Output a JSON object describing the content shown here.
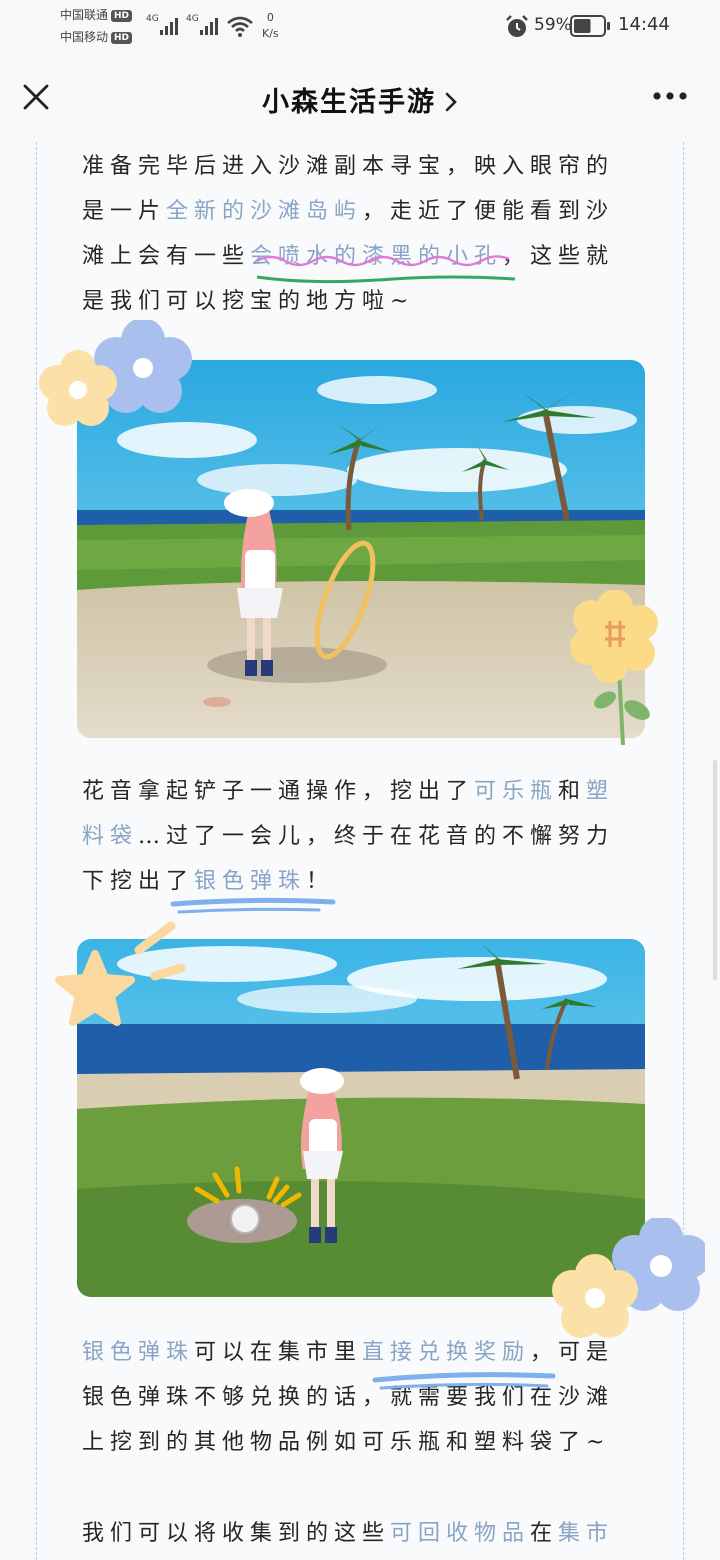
{
  "status": {
    "carrier1": "中国联通",
    "carrier2": "中国移动",
    "hd_badge": "HD",
    "network1": "4G",
    "network2": "4G",
    "speed_value": "0",
    "speed_unit": "K/s",
    "battery": "59%",
    "battery_level": 0.59,
    "time": "14:44"
  },
  "nav": {
    "title": "小森生活手游",
    "chevron": "chevron-right-icon",
    "close_icon": "close-icon",
    "more_icon": "more-icon"
  },
  "article": {
    "p1": [
      [
        {
          "t": "准备完毕后进入沙滩副本寻宝，映入眼帘的"
        }
      ],
      [
        {
          "t": "是一片"
        },
        {
          "t": "全新的沙滩岛屿",
          "h": 1
        },
        {
          "t": "，走近了便能看到沙"
        }
      ],
      [
        {
          "t": "滩上会有一些"
        },
        {
          "t": "会喷水的漆黑的小孔",
          "h": 1
        },
        {
          "t": "，这些就"
        }
      ],
      [
        {
          "t": "是我们可以挖宝的地方啦~"
        }
      ]
    ],
    "p2": [
      [
        {
          "t": "花音拿起铲子一通操作，挖出了"
        },
        {
          "t": "可乐瓶",
          "h": 1
        },
        {
          "t": "和"
        },
        {
          "t": "塑",
          "h": 1
        }
      ],
      [
        {
          "t": "料袋",
          "h": 1
        },
        {
          "t": "…过了一会儿，终于在花音的不懈努力"
        }
      ],
      [
        {
          "t": "下挖出了"
        },
        {
          "t": "银色弹珠",
          "h": 1
        },
        {
          "t": "！"
        }
      ]
    ],
    "p3": [
      [
        {
          "t": "银色弹珠",
          "h": 1
        },
        {
          "t": "可以在集市里"
        },
        {
          "t": "直接兑换奖励",
          "h": 1
        },
        {
          "t": "，可是"
        }
      ],
      [
        {
          "t": "银色弹珠不够兑换的话，就需要我们在沙滩"
        }
      ],
      [
        {
          "t": "上挖到的其他物品例如可乐瓶和塑料袋了~"
        }
      ]
    ],
    "p4": [
      [
        {
          "t": "我们可以将收集到的这些"
        },
        {
          "t": "可回收物品",
          "h": 1
        },
        {
          "t": "在"
        },
        {
          "t": "集市",
          "h": 1
        }
      ]
    ]
  },
  "colors": {
    "highlight": "#8aa4c6",
    "pink_underline": "#e07ad6",
    "green_underline": "#33a866",
    "blue_underline": "#7fb0ec",
    "sky": "#3fb6e6",
    "sea": "#1f5ea8",
    "grass": "#5f9a3a",
    "sand": "#d9cdb2"
  }
}
